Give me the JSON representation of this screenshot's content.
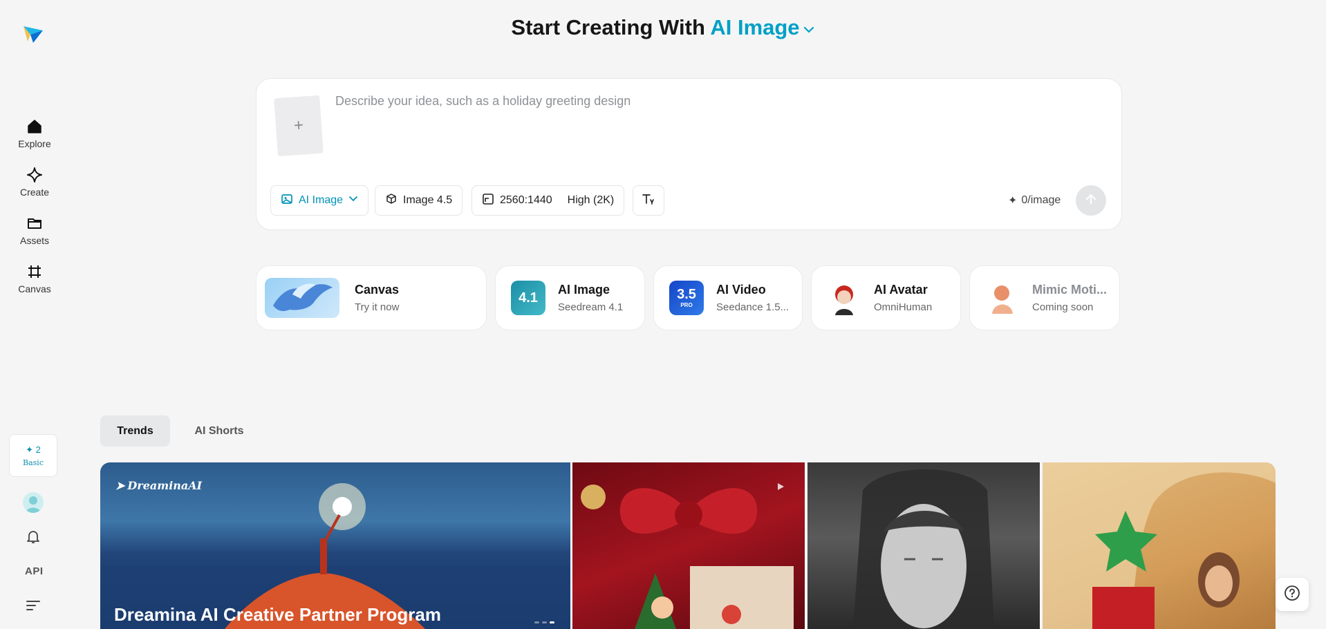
{
  "header": {
    "prefix": "Start Creating With",
    "mode": "AI Image"
  },
  "sidebar": {
    "items": [
      {
        "label": "Explore",
        "icon": "home-icon"
      },
      {
        "label": "Create",
        "icon": "diamond-icon"
      },
      {
        "label": "Assets",
        "icon": "folder-icon"
      },
      {
        "label": "Canvas",
        "icon": "canvas-icon"
      }
    ],
    "credits": {
      "count": "2",
      "tier": "Basic"
    },
    "api_label": "API"
  },
  "prompt": {
    "placeholder": "Describe your idea, such as a holiday greeting design",
    "upload_symbol": "+",
    "mode_chip": "AI Image",
    "model_chip": "Image 4.5",
    "ratio": "2560:1440",
    "quality": "High (2K)",
    "cost": "0/image"
  },
  "tools": [
    {
      "title": "Canvas",
      "subtitle": "Try it now"
    },
    {
      "title": "AI Image",
      "subtitle": "Seedream 4.1",
      "badge": "4.1"
    },
    {
      "title": "AI Video",
      "subtitle": "Seedance 1.5...",
      "badge": "3.5",
      "badge_sub": "PRO"
    },
    {
      "title": "AI Avatar",
      "subtitle": "OmniHuman"
    },
    {
      "title": "Mimic Moti...",
      "subtitle": "Coming soon"
    }
  ],
  "tabs": [
    "Trends",
    "AI Shorts"
  ],
  "gallery": {
    "banner_brand": "DreaminaAI",
    "banner_title": "Dreamina AI Creative Partner Program"
  },
  "colors": {
    "accent": "#00a0c6",
    "background": "#f5f5f6"
  }
}
